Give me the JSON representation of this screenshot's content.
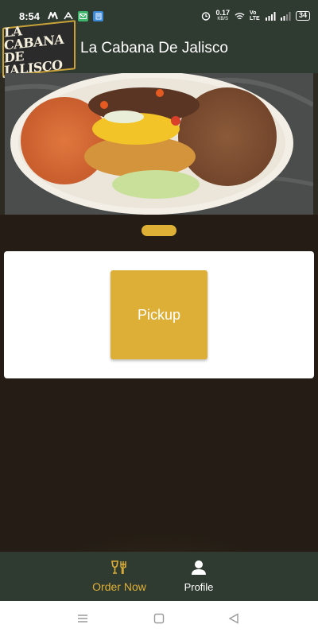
{
  "status_bar": {
    "time": "8:54",
    "net_speed_value": "0.17",
    "net_speed_unit": "KB/S",
    "network_label": "Vo LTE",
    "battery": "34",
    "icons": [
      "app-m-icon",
      "app-a-icon",
      "mail-icon",
      "app-blue-icon",
      "alarm-icon",
      "wifi-icon",
      "signal-icon"
    ]
  },
  "app_bar": {
    "logo_line1": "LA CABANA",
    "logo_line2": "DE JALISCO",
    "title": "La Cabana De Jalisco"
  },
  "card": {
    "pickup_label": "Pickup"
  },
  "bottom_nav": {
    "items": [
      {
        "label": "Order Now",
        "icon": "fork-knife-glass-icon",
        "active": true
      },
      {
        "label": "Profile",
        "icon": "person-icon",
        "active": false
      }
    ]
  },
  "system_nav": [
    "menu-icon",
    "home-square-icon",
    "back-triangle-icon"
  ],
  "colors": {
    "bar_green": "#2f3a31",
    "accent_gold": "#ddaf37",
    "card_white": "#ffffff"
  }
}
